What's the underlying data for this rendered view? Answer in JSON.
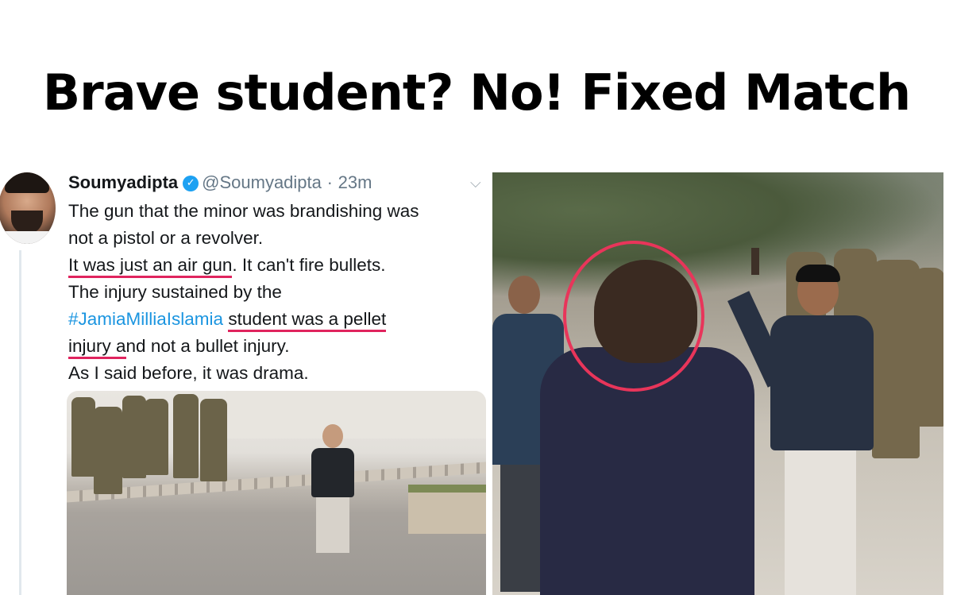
{
  "headline": "Brave student? No! Fixed Match",
  "tweet": {
    "name": "Soumyadipta",
    "handle": "@Soumyadipta",
    "separator": "·",
    "time": "23m",
    "lines": [
      {
        "a": "The gun that the minor was brandishing was"
      },
      {
        "a": "not a pistol or a revolver."
      },
      {
        "u1": "It was just an air gun",
        "a": ". It can't fire bullets."
      },
      {
        "a": "The injury sustained by the"
      },
      {
        "hashtag": "#JamiaMilliaIslamia",
        "u1": "student was a pellet"
      },
      {
        "u1": "injury a",
        "a": "nd not a bullet injury."
      },
      {
        "a": "As I said before, it was drama."
      }
    ]
  },
  "icons": {
    "verified": "verified-badge-icon",
    "menu": "chevron-down-icon"
  },
  "colors": {
    "underline": "#e0245e",
    "hashtag": "#1b95e0",
    "verified": "#1da1f2",
    "circle": "#e8355a"
  }
}
